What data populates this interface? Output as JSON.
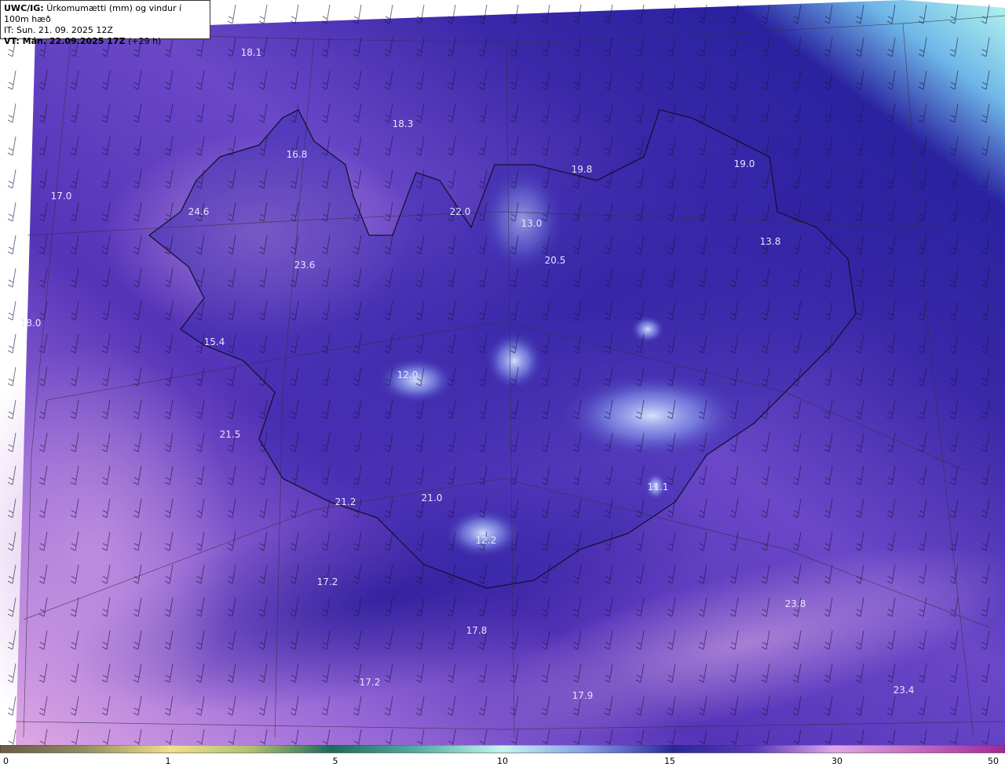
{
  "header": {
    "model": "UWC/IG:",
    "title": "Úrkomumætti (mm) og vindur í 100m hæð",
    "init_time": "IT: Sun. 21. 09. 2025 12Z",
    "valid_prefix": "VT: Mán. 22.09.2025 17Z",
    "valid_suffix": "(+29 h)"
  },
  "colors": {
    "background_purple": "#5a3fb8",
    "deep_blue": "#2a1fa0",
    "light_pink": "#d9a8e0",
    "cyan_band": "#a8f0ee",
    "highlight_white": "#cfe4ff"
  },
  "map_labels": [
    {
      "text": "18.1"
    },
    {
      "text": "18.3"
    },
    {
      "text": "16.8"
    },
    {
      "text": "17.0"
    },
    {
      "text": "24.6"
    },
    {
      "text": "22.0"
    },
    {
      "text": "13.0"
    },
    {
      "text": "19.8"
    },
    {
      "text": "19.0"
    },
    {
      "text": "13.8"
    },
    {
      "text": "20.5"
    },
    {
      "text": "23.6"
    },
    {
      "text": "18.0"
    },
    {
      "text": "15.4"
    },
    {
      "text": "12.0"
    },
    {
      "text": "21.5"
    },
    {
      "text": "21.2"
    },
    {
      "text": "21.0"
    },
    {
      "text": "12.2"
    },
    {
      "text": "11.1"
    },
    {
      "text": "17.2"
    },
    {
      "text": "17.8"
    },
    {
      "text": "23.8"
    },
    {
      "text": "17.2"
    },
    {
      "text": "17.9"
    },
    {
      "text": "23.4"
    }
  ],
  "colorbar": {
    "ticks": [
      "0",
      "1",
      "5",
      "10",
      "15",
      "30",
      "50"
    ]
  }
}
